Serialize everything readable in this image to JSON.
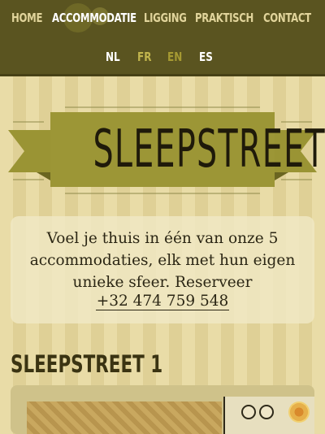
{
  "nav": {
    "items": [
      {
        "label": "HOME",
        "active": false
      },
      {
        "label": "ACCOMMODATIE",
        "active": true
      },
      {
        "label": "LIGGING",
        "active": false
      },
      {
        "label": "PRAKTISCH",
        "active": false
      },
      {
        "label": "CONTACT",
        "active": false
      }
    ]
  },
  "languages": [
    {
      "label": "NL",
      "current": true
    },
    {
      "label": "FR",
      "current": false
    },
    {
      "label": "EN",
      "current": false
    },
    {
      "label": "ES",
      "current": false
    }
  ],
  "logo": {
    "text": "SLEEPSTREET"
  },
  "intro": {
    "text": "Voel je thuis in één van onze 5 accommodaties, elk met hun eigen unieke sfeer. Reserveer",
    "phone": "+32 474 759 548"
  },
  "section": {
    "title": "SLEEPSTREET 1"
  },
  "colors": {
    "topbar": "#5a5420",
    "ribbon": "#9a9434",
    "background": "#e6d8a2",
    "text": "#2b2614"
  }
}
